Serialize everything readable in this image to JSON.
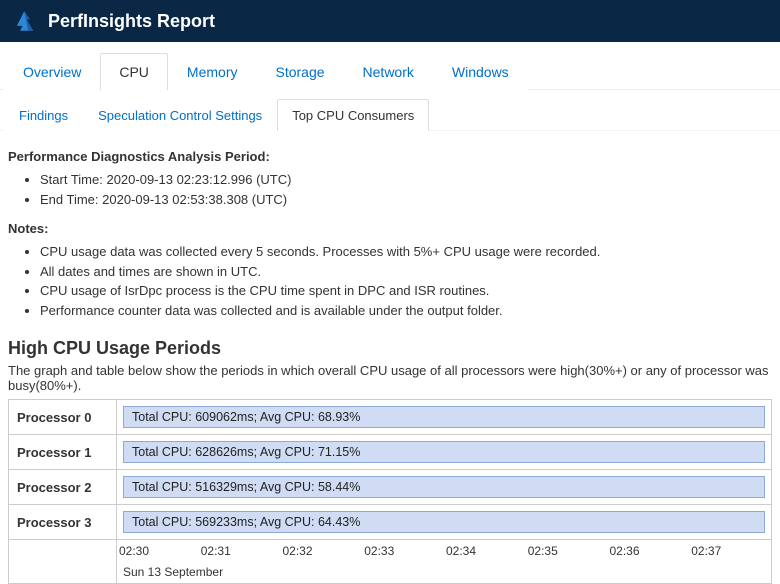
{
  "header": {
    "title": "PerfInsights Report"
  },
  "mainTabs": [
    {
      "label": "Overview",
      "active": false
    },
    {
      "label": "CPU",
      "active": true
    },
    {
      "label": "Memory",
      "active": false
    },
    {
      "label": "Storage",
      "active": false
    },
    {
      "label": "Network",
      "active": false
    },
    {
      "label": "Windows",
      "active": false
    }
  ],
  "subTabs": [
    {
      "label": "Findings",
      "active": false
    },
    {
      "label": "Speculation Control Settings",
      "active": false
    },
    {
      "label": "Top CPU Consumers",
      "active": true
    }
  ],
  "analysis": {
    "heading": "Performance Diagnostics Analysis Period:",
    "start": "Start Time: 2020-09-13 02:23:12.996 (UTC)",
    "end": "End Time: 2020-09-13 02:53:38.308 (UTC)"
  },
  "notes": {
    "heading": "Notes:",
    "items": [
      "CPU usage data was collected every 5 seconds. Processes with 5%+ CPU usage were recorded.",
      "All dates and times are shown in UTC.",
      "CPU usage of IsrDpc process is the CPU time spent in DPC and ISR routines.",
      "Performance counter data was collected and is available under the output folder."
    ]
  },
  "highCpu": {
    "heading": "High CPU Usage Periods",
    "desc": "The graph and table below show the periods in which overall CPU usage of all processors were high(30%+) or any of processor was busy(80%+).",
    "rows": [
      {
        "label": "Processor 0",
        "text": "Total CPU: 609062ms; Avg CPU: 68.93%"
      },
      {
        "label": "Processor 1",
        "text": "Total CPU: 628626ms; Avg CPU: 71.15%"
      },
      {
        "label": "Processor 2",
        "text": "Total CPU: 516329ms; Avg CPU: 58.44%"
      },
      {
        "label": "Processor 3",
        "text": "Total CPU: 569233ms; Avg CPU: 64.43%"
      }
    ],
    "ticks": [
      "02:30",
      "02:31",
      "02:32",
      "02:33",
      "02:34",
      "02:35",
      "02:36",
      "02:37"
    ],
    "axisDate": "Sun 13 September"
  }
}
